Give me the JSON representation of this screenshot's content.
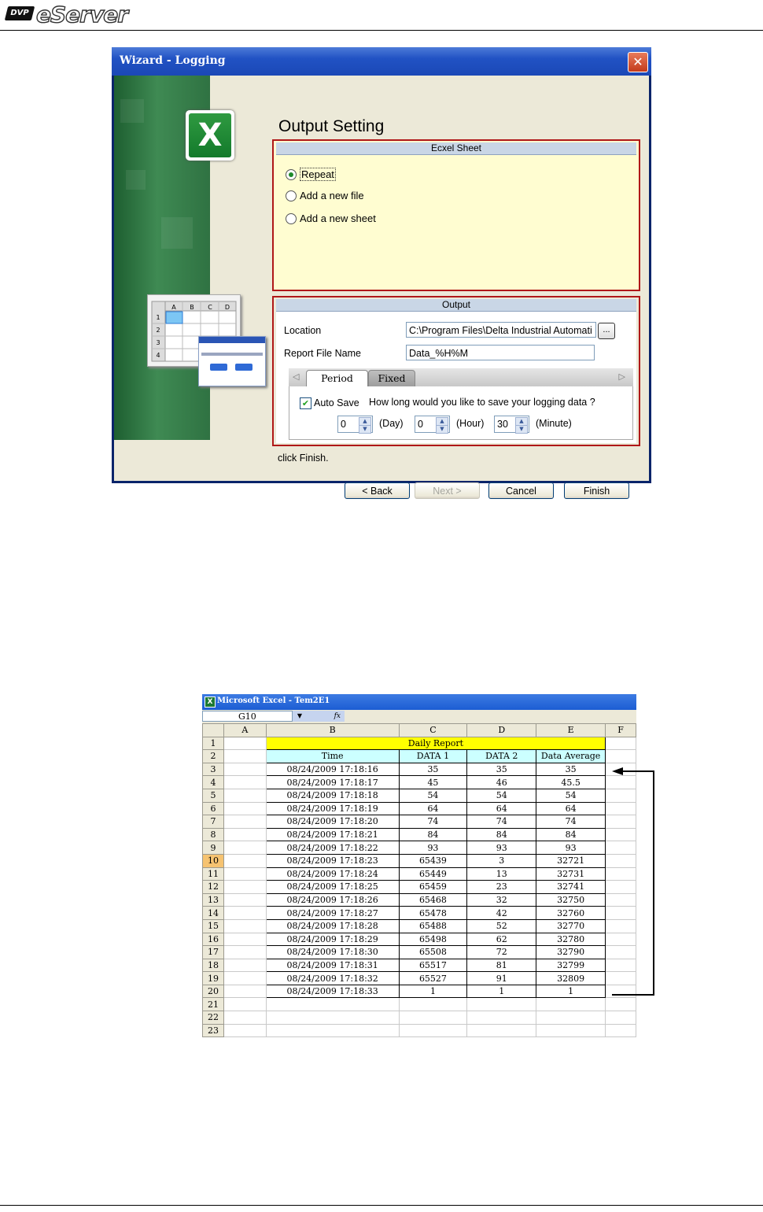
{
  "header": {
    "logo_badge": "DVP",
    "logo_text": "eServer"
  },
  "wizard": {
    "title": "Wizard - Logging",
    "close": "✕",
    "heading": "Output Setting",
    "side_icon": "X",
    "side_sheet_cols": [
      "A",
      "B",
      "C",
      "D"
    ],
    "side_sheet_rows": [
      "1",
      "2",
      "3",
      "4"
    ],
    "excel_group": {
      "title": "Ecxel Sheet",
      "options": [
        {
          "label": "Repeat",
          "selected": true
        },
        {
          "label": "Add a new file",
          "selected": false
        },
        {
          "label": "Add a new sheet",
          "selected": false
        }
      ]
    },
    "output_group": {
      "title": "Output",
      "location_label": "Location",
      "location_value": "C:\\Program Files\\Delta Industrial Automati",
      "browse": "...",
      "report_label": "Report File Name",
      "report_value": "Data_%H%M",
      "tabs": [
        "Period",
        "Fixed"
      ],
      "autosave_label": "Auto Save",
      "autosave_checked": true,
      "question": "How long would you like to save your logging data ?",
      "day_value": "0",
      "day_unit": "(Day)",
      "hour_value": "0",
      "hour_unit": "(Hour)",
      "minute_value": "30",
      "minute_unit": "(Minute)"
    },
    "hint": "click Finish.",
    "buttons": {
      "back": "< Back",
      "next": "Next >",
      "cancel": "Cancel",
      "finish": "Finish"
    }
  },
  "excel": {
    "title": "Microsoft Excel - Tem2E1",
    "name_box": "G10",
    "fx": "fx",
    "columns": [
      "A",
      "B",
      "C",
      "D",
      "E",
      "F"
    ],
    "report_title": "Daily Report",
    "headers": [
      "Time",
      "DATA 1",
      "DATA 2",
      "Data Average"
    ],
    "selected_row": "10",
    "rows": [
      [
        "08/24/2009 17:18:16",
        "35",
        "35",
        "35"
      ],
      [
        "08/24/2009 17:18:17",
        "45",
        "46",
        "45.5"
      ],
      [
        "08/24/2009 17:18:18",
        "54",
        "54",
        "54"
      ],
      [
        "08/24/2009 17:18:19",
        "64",
        "64",
        "64"
      ],
      [
        "08/24/2009 17:18:20",
        "74",
        "74",
        "74"
      ],
      [
        "08/24/2009 17:18:21",
        "84",
        "84",
        "84"
      ],
      [
        "08/24/2009 17:18:22",
        "93",
        "93",
        "93"
      ],
      [
        "08/24/2009 17:18:23",
        "65439",
        "3",
        "32721"
      ],
      [
        "08/24/2009 17:18:24",
        "65449",
        "13",
        "32731"
      ],
      [
        "08/24/2009 17:18:25",
        "65459",
        "23",
        "32741"
      ],
      [
        "08/24/2009 17:18:26",
        "65468",
        "32",
        "32750"
      ],
      [
        "08/24/2009 17:18:27",
        "65478",
        "42",
        "32760"
      ],
      [
        "08/24/2009 17:18:28",
        "65488",
        "52",
        "32770"
      ],
      [
        "08/24/2009 17:18:29",
        "65498",
        "62",
        "32780"
      ],
      [
        "08/24/2009 17:18:30",
        "65508",
        "72",
        "32790"
      ],
      [
        "08/24/2009 17:18:31",
        "65517",
        "81",
        "32799"
      ],
      [
        "08/24/2009 17:18:32",
        "65527",
        "91",
        "32809"
      ],
      [
        "08/24/2009 17:18:33",
        "1",
        "1",
        "1"
      ]
    ],
    "empty_rows": [
      "21",
      "22",
      "23"
    ]
  }
}
